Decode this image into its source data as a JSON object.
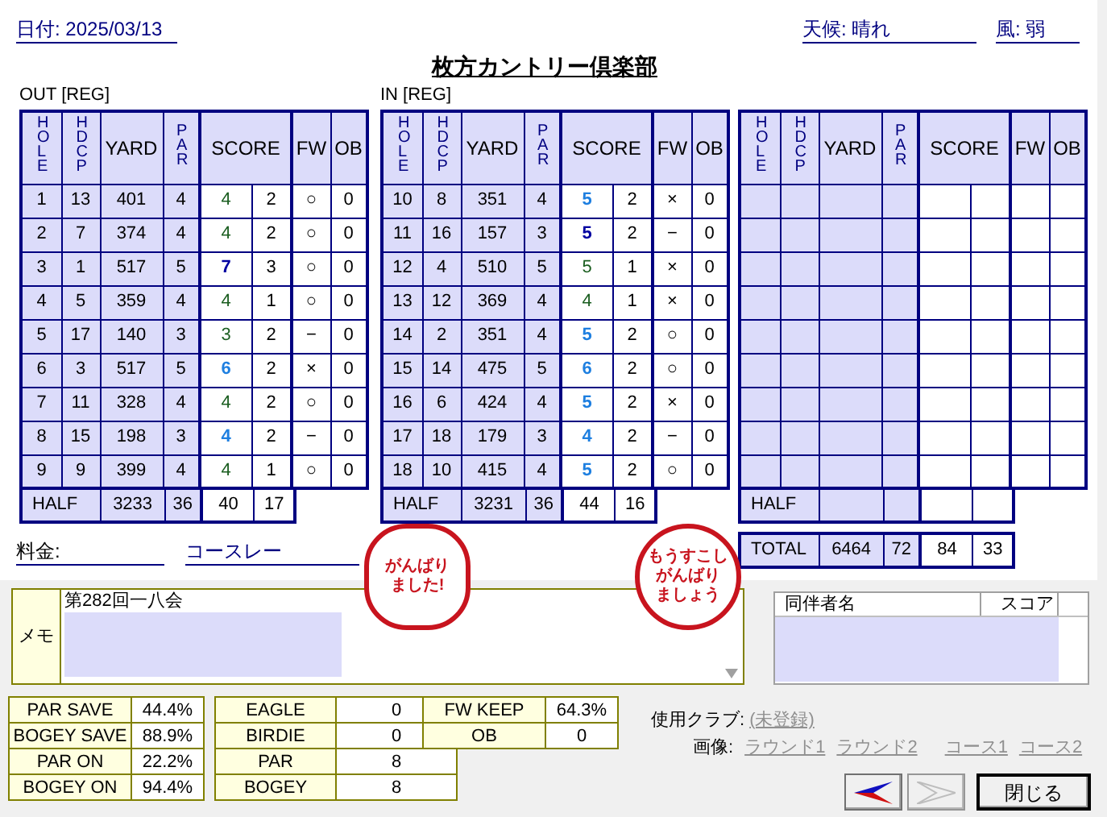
{
  "header": {
    "date": "日付: 2025/03/13",
    "weather": "天候: 晴れ",
    "wind": "風: 弱",
    "title": "枚方カントリー倶楽部"
  },
  "out": {
    "label": "OUT [REG]",
    "columns": [
      {
        "label": "HOLE",
        "kind": "vertical"
      },
      {
        "label": "HDCP",
        "kind": "vertical"
      },
      {
        "label": "YARD",
        "kind": "normal"
      },
      {
        "label": "PAR",
        "kind": "vertical"
      },
      {
        "label": "SCORE",
        "kind": "score"
      },
      {
        "label": "FW",
        "kind": "normal"
      },
      {
        "label": "OB",
        "kind": "normal"
      }
    ],
    "rows": [
      {
        "hole": "1",
        "hdcp": "13",
        "yard": "401",
        "par": "4",
        "score": "4",
        "putts": "2",
        "fw": "○",
        "ob": "0",
        "color": "#1b5e20",
        "bold": false
      },
      {
        "hole": "2",
        "hdcp": "7",
        "yard": "374",
        "par": "4",
        "score": "4",
        "putts": "2",
        "fw": "○",
        "ob": "0",
        "color": "#1b5e20",
        "bold": false
      },
      {
        "hole": "3",
        "hdcp": "1",
        "yard": "517",
        "par": "5",
        "score": "7",
        "putts": "3",
        "fw": "○",
        "ob": "0",
        "color": "#0000a0",
        "bold": true
      },
      {
        "hole": "4",
        "hdcp": "5",
        "yard": "359",
        "par": "4",
        "score": "4",
        "putts": "1",
        "fw": "○",
        "ob": "0",
        "color": "#1b5e20",
        "bold": false
      },
      {
        "hole": "5",
        "hdcp": "17",
        "yard": "140",
        "par": "3",
        "score": "3",
        "putts": "2",
        "fw": "−",
        "ob": "0",
        "color": "#1b5e20",
        "bold": false
      },
      {
        "hole": "6",
        "hdcp": "3",
        "yard": "517",
        "par": "5",
        "score": "6",
        "putts": "2",
        "fw": "×",
        "ob": "0",
        "color": "#1e7fe0",
        "bold": true
      },
      {
        "hole": "7",
        "hdcp": "11",
        "yard": "328",
        "par": "4",
        "score": "4",
        "putts": "2",
        "fw": "○",
        "ob": "0",
        "color": "#1b5e20",
        "bold": false
      },
      {
        "hole": "8",
        "hdcp": "15",
        "yard": "198",
        "par": "3",
        "score": "4",
        "putts": "2",
        "fw": "−",
        "ob": "0",
        "color": "#1e7fe0",
        "bold": true
      },
      {
        "hole": "9",
        "hdcp": "9",
        "yard": "399",
        "par": "4",
        "score": "4",
        "putts": "1",
        "fw": "○",
        "ob": "0",
        "color": "#1b5e20",
        "bold": false
      }
    ],
    "half": {
      "label": "HALF",
      "yard": "3233",
      "par": "36",
      "score": "40",
      "putts": "17"
    }
  },
  "in": {
    "label": "IN [REG]",
    "columns": [
      {
        "label": "HOLE",
        "kind": "vertical"
      },
      {
        "label": "HDCP",
        "kind": "vertical"
      },
      {
        "label": "YARD",
        "kind": "normal"
      },
      {
        "label": "PAR",
        "kind": "vertical"
      },
      {
        "label": "SCORE",
        "kind": "score"
      },
      {
        "label": "FW",
        "kind": "normal"
      },
      {
        "label": "OB",
        "kind": "normal"
      }
    ],
    "rows": [
      {
        "hole": "10",
        "hdcp": "8",
        "yard": "351",
        "par": "4",
        "score": "5",
        "putts": "2",
        "fw": "×",
        "ob": "0",
        "color": "#1e7fe0",
        "bold": true
      },
      {
        "hole": "11",
        "hdcp": "16",
        "yard": "157",
        "par": "3",
        "score": "5",
        "putts": "2",
        "fw": "−",
        "ob": "0",
        "color": "#0000a0",
        "bold": true
      },
      {
        "hole": "12",
        "hdcp": "4",
        "yard": "510",
        "par": "5",
        "score": "5",
        "putts": "1",
        "fw": "×",
        "ob": "0",
        "color": "#1b5e20",
        "bold": false
      },
      {
        "hole": "13",
        "hdcp": "12",
        "yard": "369",
        "par": "4",
        "score": "4",
        "putts": "1",
        "fw": "×",
        "ob": "0",
        "color": "#1b5e20",
        "bold": false
      },
      {
        "hole": "14",
        "hdcp": "2",
        "yard": "351",
        "par": "4",
        "score": "5",
        "putts": "2",
        "fw": "○",
        "ob": "0",
        "color": "#1e7fe0",
        "bold": true
      },
      {
        "hole": "15",
        "hdcp": "14",
        "yard": "475",
        "par": "5",
        "score": "6",
        "putts": "2",
        "fw": "○",
        "ob": "0",
        "color": "#1e7fe0",
        "bold": true
      },
      {
        "hole": "16",
        "hdcp": "6",
        "yard": "424",
        "par": "4",
        "score": "5",
        "putts": "2",
        "fw": "×",
        "ob": "0",
        "color": "#1e7fe0",
        "bold": true
      },
      {
        "hole": "17",
        "hdcp": "18",
        "yard": "179",
        "par": "3",
        "score": "4",
        "putts": "2",
        "fw": "−",
        "ob": "0",
        "color": "#1e7fe0",
        "bold": true
      },
      {
        "hole": "18",
        "hdcp": "10",
        "yard": "415",
        "par": "4",
        "score": "5",
        "putts": "2",
        "fw": "○",
        "ob": "0",
        "color": "#1e7fe0",
        "bold": true
      }
    ],
    "half": {
      "label": "HALF",
      "yard": "3231",
      "par": "36",
      "score": "44",
      "putts": "16"
    }
  },
  "extra": {
    "columns": [
      {
        "label": "HOLE",
        "kind": "vertical"
      },
      {
        "label": "HDCP",
        "kind": "vertical"
      },
      {
        "label": "YARD",
        "kind": "normal"
      },
      {
        "label": "PAR",
        "kind": "vertical"
      },
      {
        "label": "SCORE",
        "kind": "score"
      },
      {
        "label": "FW",
        "kind": "normal"
      },
      {
        "label": "OB",
        "kind": "normal"
      }
    ],
    "half_label": "HALF",
    "total": {
      "label": "TOTAL",
      "yard": "6464",
      "par": "72",
      "score": "84",
      "putts": "33"
    }
  },
  "fee_label": "料金:",
  "course_rate_label": "コースレー",
  "stamps": [
    {
      "lines": [
        "がんばり",
        "ました!"
      ],
      "kind": "flower"
    },
    {
      "lines": [
        "もうすこし",
        "がんばり",
        "ましょう"
      ],
      "kind": "circle"
    }
  ],
  "memo": {
    "label": "メモ",
    "text": "第282回一八会"
  },
  "companions": {
    "columns": [
      "同伴者名",
      "スコア"
    ]
  },
  "stats": [
    [
      {
        "label": "PAR SAVE",
        "value": "44.4%"
      },
      {
        "label": "BOGEY SAVE",
        "value": "88.9%"
      },
      {
        "label": "PAR ON",
        "value": "22.2%"
      },
      {
        "label": "BOGEY ON",
        "value": "94.4%"
      }
    ],
    [
      {
        "label": "EAGLE",
        "value": "0"
      },
      {
        "label": "BIRDIE",
        "value": "0"
      },
      {
        "label": "PAR",
        "value": "8"
      },
      {
        "label": "BOGEY",
        "value": "8"
      }
    ],
    [
      {
        "label": "FW KEEP",
        "value": "64.3%"
      },
      {
        "label": "OB",
        "value": "0"
      }
    ]
  ],
  "clubs": {
    "label": "使用クラブ:",
    "link": "(未登録)"
  },
  "images": {
    "label": "画像:",
    "links": [
      "ラウンド1",
      "ラウンド2",
      "コース1",
      "コース2"
    ]
  },
  "buttons": [
    {
      "kind": "back",
      "disabled": false
    },
    {
      "kind": "forward",
      "disabled": true
    },
    {
      "kind": "text",
      "label": "閉じる",
      "disabled": false
    }
  ]
}
